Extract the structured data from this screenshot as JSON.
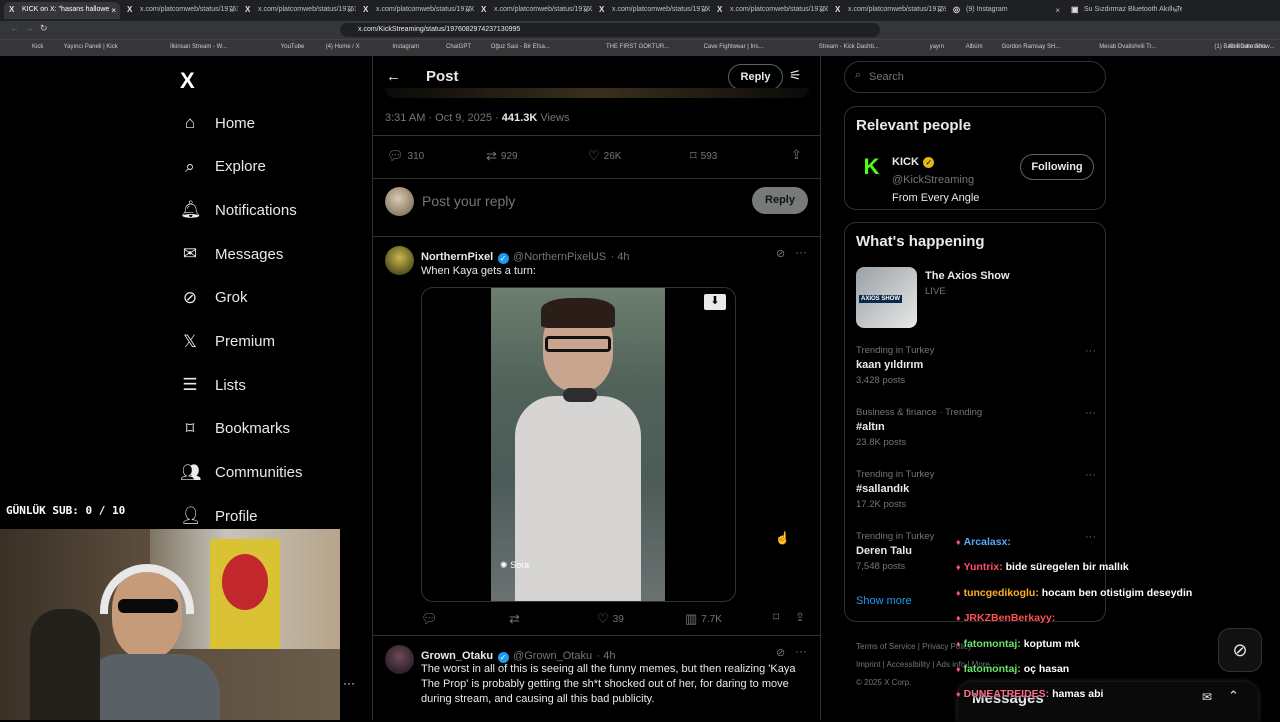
{
  "browser": {
    "tabs": [
      {
        "label": "KICK on X: \"hasans hallowe",
        "fav": "X",
        "active": true
      },
      {
        "label": "x.com/platcomweb/status/19761",
        "fav": "X"
      },
      {
        "label": "x.com/platcomweb/status/19761",
        "fav": "X"
      },
      {
        "label": "x.com/platcomweb/status/19760",
        "fav": "X"
      },
      {
        "label": "x.com/platcomweb/status/19760",
        "fav": "X"
      },
      {
        "label": "x.com/platcomweb/status/19760",
        "fav": "X"
      },
      {
        "label": "x.com/platcomweb/status/19760",
        "fav": "X"
      },
      {
        "label": "x.com/platcomweb/status/19759",
        "fav": "X"
      },
      {
        "label": "(9) Instagram",
        "fav": "◎"
      },
      {
        "label": "Su Sızdırmaz Bluetooth Akıllı Telefon",
        "fav": "▣"
      }
    ],
    "url": "x.com/KickStreaming/status/1976082974237130995",
    "bookmarks": [
      "Kick",
      "Yayıncı Paneli | Kick",
      "İlkinsan Stream - W...",
      "YouTube",
      "(4) Home / X",
      "Instagram",
      "ChatGPT",
      "Oğuz Sasi - Bir Efsa...",
      "THE FIRST GOKTUR...",
      "Cave Fightwear | Ins...",
      "Stream - Kick Dashb...",
      "yayın",
      "Albüm",
      "Gordon Ramsay SH...",
      "Merab Dvalishvili Tr...",
      "(1) Balon Date Show...",
      "All Bookmarks"
    ]
  },
  "sidebar": {
    "logo": "X",
    "items": [
      {
        "label": "Home",
        "icon": "home-icon"
      },
      {
        "label": "Explore",
        "icon": "search-icon"
      },
      {
        "label": "Notifications",
        "icon": "bell-icon"
      },
      {
        "label": "Messages",
        "icon": "mail-icon"
      },
      {
        "label": "Grok",
        "icon": "grok-icon"
      },
      {
        "label": "Premium",
        "icon": "x-icon"
      },
      {
        "label": "Lists",
        "icon": "list-icon"
      },
      {
        "label": "Bookmarks",
        "icon": "bookmark-icon"
      },
      {
        "label": "Communities",
        "icon": "people-icon"
      },
      {
        "label": "Profile",
        "icon": "person-icon"
      }
    ]
  },
  "post": {
    "header": "Post",
    "reply_btn": "Reply",
    "timestamp": "3:31 AM · Oct 9, 2025 ·",
    "views": "441.3K",
    "views_label": "Views",
    "stats": {
      "replies": "310",
      "reposts": "929",
      "likes": "26K",
      "bookmarks": "593"
    },
    "reply_placeholder": "Post your reply",
    "reply_submit": "Reply"
  },
  "tweets": [
    {
      "name": "NorthernPixel",
      "handle": "@NorthernPixelUS",
      "time": "· 4h",
      "text": "When Kaya gets a turn:",
      "media_label": "Sora",
      "likes": "39",
      "views": "7.7K"
    },
    {
      "name": "Grown_Otaku",
      "handle": "@Grown_Otaku",
      "time": "· 4h",
      "text": "The worst in all of this is seeing all the funny memes, but then realizing 'Kaya The Prop' is probably getting the sh*t shocked out of her, for daring to move during stream, and causing all this bad publicity."
    }
  ],
  "right": {
    "search_placeholder": "Search",
    "relevant_title": "Relevant people",
    "person": {
      "name": "KICK",
      "handle": "@KickStreaming",
      "bio": "From Every Angle",
      "button": "Following"
    },
    "happening_title": "What's happening",
    "show": {
      "title": "The Axios Show",
      "status": "LIVE",
      "thumb_text": "AXIOS SHOW"
    },
    "trends": [
      {
        "cat": "Trending in Turkey",
        "name": "kaan yıldırım",
        "posts": "3,428 posts"
      },
      {
        "cat": "Business & finance · Trending",
        "name": "#altın",
        "posts": "23.8K posts"
      },
      {
        "cat": "Trending in Turkey",
        "name": "#sallandık",
        "posts": "17.2K posts"
      },
      {
        "cat": "Trending in Turkey",
        "name": "Deren Talu",
        "posts": "7,548 posts"
      }
    ],
    "show_more": "Show more",
    "footer": [
      "Terms of Service",
      "Privacy Policy",
      "Imprint",
      "Accessibility",
      "Ads info",
      "More ···"
    ],
    "copyright": "© 2025 X Corp.",
    "messages": "Messages"
  },
  "overlay": {
    "sub_counter": "GÜNLÜK SUB: 0 / 10",
    "chat": [
      {
        "user": "Arcalasx:",
        "color": "#5aa8ff",
        "msg": ""
      },
      {
        "user": "Yuntrix:",
        "color": "#ff4d6a",
        "msg": "bide süregelen bir mallık"
      },
      {
        "user": "tuncgedikoglu:",
        "color": "#ffb020",
        "msg": "hocam ben otistigim deseydin"
      },
      {
        "user": "JRKZBenBerkayy:",
        "color": "#ff5050",
        "msg": ""
      },
      {
        "user": "fatomontaj:",
        "color": "#6be36b",
        "msg": "koptum mk"
      },
      {
        "user": "fatomontaj:",
        "color": "#6be36b",
        "msg": "oç hasan"
      },
      {
        "user": "DUNEATREIDES:",
        "color": "#ff6b8a",
        "msg": "hamas abi"
      }
    ]
  },
  "colors": {
    "accent": "#1d9bf0",
    "kick": "#53fc18",
    "border": "#2f3336"
  }
}
